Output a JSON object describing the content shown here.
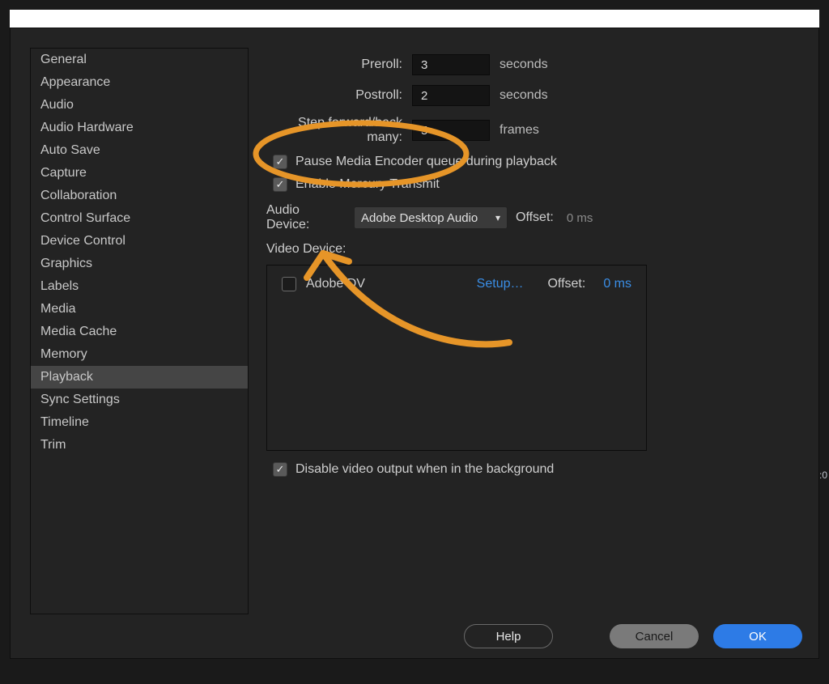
{
  "sidebar": {
    "items": [
      {
        "label": "General"
      },
      {
        "label": "Appearance"
      },
      {
        "label": "Audio"
      },
      {
        "label": "Audio Hardware"
      },
      {
        "label": "Auto Save"
      },
      {
        "label": "Capture"
      },
      {
        "label": "Collaboration"
      },
      {
        "label": "Control Surface"
      },
      {
        "label": "Device Control"
      },
      {
        "label": "Graphics"
      },
      {
        "label": "Labels"
      },
      {
        "label": "Media"
      },
      {
        "label": "Media Cache"
      },
      {
        "label": "Memory"
      },
      {
        "label": "Playback"
      },
      {
        "label": "Sync Settings"
      },
      {
        "label": "Timeline"
      },
      {
        "label": "Trim"
      }
    ],
    "selectedIndex": 14
  },
  "settings": {
    "preroll": {
      "label": "Preroll:",
      "value": "3",
      "unit": "seconds"
    },
    "postroll": {
      "label": "Postroll:",
      "value": "2",
      "unit": "seconds"
    },
    "step_many": {
      "label": "Step forward/back many:",
      "value": "5",
      "unit": "frames"
    },
    "pause_encoder": {
      "checked": true,
      "label": "Pause Media Encoder queue during playback"
    },
    "enable_mercury": {
      "checked": true,
      "label": "Enable Mercury Transmit"
    },
    "audio_device": {
      "label": "Audio Device:",
      "selected": "Adobe Desktop Audio",
      "offset_label": "Offset:",
      "offset_value": "0 ms"
    },
    "video_device_label": "Video Device:",
    "video_device": {
      "checked": false,
      "name": "Adobe DV",
      "setup": "Setup…",
      "offset_label": "Offset:",
      "offset_value": "0 ms"
    },
    "disable_bg": {
      "checked": true,
      "label": "Disable video output when in the background"
    }
  },
  "buttons": {
    "help": "Help",
    "cancel": "Cancel",
    "ok": "OK"
  },
  "annotation_color": "#e69528",
  "bg_timecode": ":0"
}
